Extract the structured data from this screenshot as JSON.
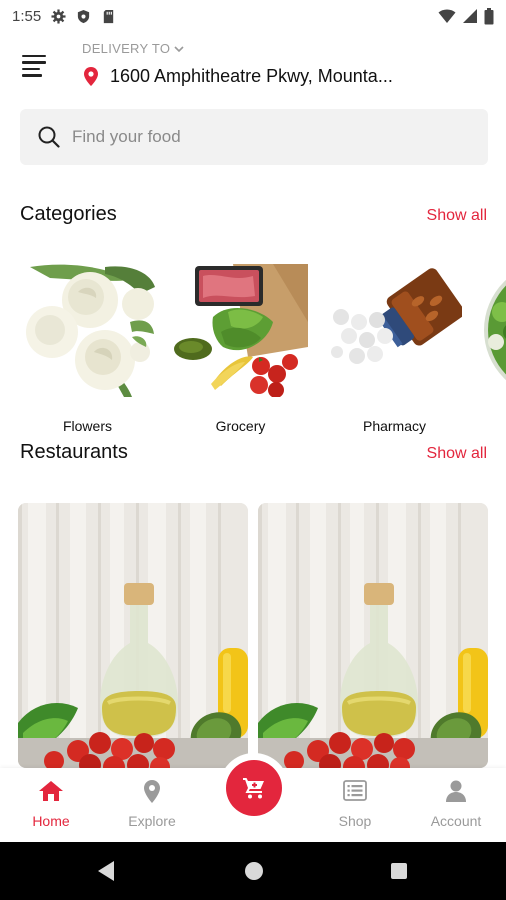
{
  "status_bar": {
    "time": "1:55",
    "icons": [
      "gear-icon",
      "shield-icon",
      "sd-card-icon",
      "wifi-icon",
      "signal-icon",
      "battery-icon"
    ]
  },
  "header": {
    "menu_icon": "hamburger-menu-icon",
    "delivery_label": "DELIVERY TO",
    "address": "1600 Amphitheatre Pkwy, Mounta...",
    "location_icon": "location-pin-icon"
  },
  "search": {
    "placeholder": "Find your food",
    "value": ""
  },
  "categories": {
    "title": "Categories",
    "show_all": "Show all",
    "items": [
      {
        "label": "Flowers",
        "image": "white-roses-photo"
      },
      {
        "label": "Grocery",
        "image": "grocery-bag-photo"
      },
      {
        "label": "Pharmacy",
        "image": "pills-bottle-photo"
      },
      {
        "label": "",
        "image": "salad-bowl-photo"
      }
    ]
  },
  "restaurants": {
    "title": "Restaurants",
    "show_all": "Show all",
    "cards": [
      {
        "image": "olive-oil-vegetables-photo"
      },
      {
        "image": "olive-oil-vegetables-photo"
      }
    ]
  },
  "bottom_nav": {
    "items": [
      {
        "label": "Home",
        "icon": "home-icon",
        "active": true
      },
      {
        "label": "Explore",
        "icon": "location-pin-icon",
        "active": false
      },
      {
        "label": "Shop",
        "icon": "list-icon",
        "active": false
      },
      {
        "label": "Account",
        "icon": "person-icon",
        "active": false
      }
    ],
    "cart_icon": "cart-icon"
  },
  "colors": {
    "accent": "#e3263d",
    "muted": "#9a9a9a",
    "search_bg": "#f2f2f2"
  }
}
